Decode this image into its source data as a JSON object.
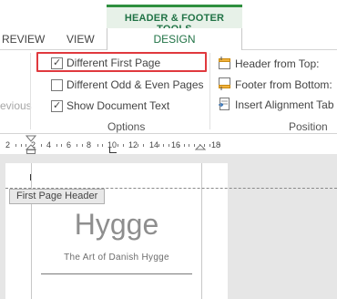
{
  "ribbon": {
    "contextual_tab_group": "HEADER & FOOTER TOOLS",
    "tabs": [
      {
        "label": "REVIEW",
        "active": false
      },
      {
        "label": "VIEW",
        "active": false
      },
      {
        "label": "DESIGN",
        "active": true
      }
    ],
    "previous_group_fragment": "revious",
    "options_group": {
      "label": "Options",
      "items": [
        {
          "label": "Different First Page",
          "checked": true,
          "highlighted": true
        },
        {
          "label": "Different Odd & Even Pages",
          "checked": false
        },
        {
          "label": "Show Document Text",
          "checked": true
        }
      ]
    },
    "position_group": {
      "label": "Position",
      "items": [
        {
          "label": "Header from Top:",
          "icon": "header-from-top-icon"
        },
        {
          "label": "Footer from Bottom:",
          "icon": "footer-from-bottom-icon"
        },
        {
          "label": "Insert Alignment Tab",
          "icon": "insert-alignment-tab-icon"
        }
      ]
    }
  },
  "ruler": {
    "numbers": [
      "2",
      "2",
      "4",
      "6",
      "8",
      "10",
      "12",
      "14",
      "16",
      "18"
    ]
  },
  "document": {
    "header_tag": "First Page Header",
    "title": "Hygge",
    "subtitle": "The Art of Danish Hygge"
  },
  "colors": {
    "accent_green": "#217346",
    "highlight_red": "#e0393e"
  }
}
